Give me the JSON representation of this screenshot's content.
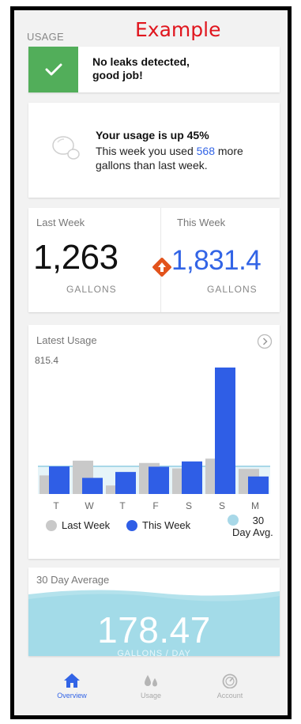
{
  "watermark": "Example",
  "section_label": "USAGE",
  "leak": {
    "message_line1": "No leaks detected,",
    "message_line2": "good job!"
  },
  "usage_up": {
    "title": "Your usage is up 45%",
    "desc_before": "This week you used ",
    "highlight": "568",
    "desc_after": " more gallons than last week."
  },
  "compare": {
    "last_label": "Last Week",
    "this_label": "This Week",
    "last_value": "1,263",
    "this_value": "1,831.4",
    "last_unit": "GALLONS",
    "this_unit": "GALLONS"
  },
  "chart_card": {
    "title": "Latest Usage",
    "next_icon": "chevron-right-circle-icon"
  },
  "chart_data": {
    "type": "bar",
    "title": "Latest Usage",
    "categories": [
      "T",
      "W",
      "T",
      "F",
      "S",
      "S",
      "M"
    ],
    "series": [
      {
        "name": "Last Week",
        "color": "#c9c9c9",
        "values": [
          120,
          215,
          55,
          200,
          165,
          228,
          162
        ]
      },
      {
        "name": "This Week",
        "color": "#2f5ee6",
        "values": [
          178,
          104,
          142,
          176,
          210,
          815.4,
          113
        ]
      }
    ],
    "reference": {
      "name": "30 Day Avg.",
      "value": 178.47,
      "color": "#a8d8e8"
    },
    "ymax_label": "815.4",
    "ylim": [
      0,
      815.4
    ]
  },
  "legend": {
    "last_week": "Last Week",
    "this_week": "This Week",
    "avg_line1": "30",
    "avg_line2": "Day Avg."
  },
  "average": {
    "title": "30 Day Average",
    "value": "178.47",
    "unit": "GALLONS / DAY"
  },
  "nav": {
    "items": [
      {
        "label": "Overview",
        "icon": "home-icon",
        "active": true
      },
      {
        "label": "Usage",
        "icon": "water-drops-icon",
        "active": false
      },
      {
        "label": "Account",
        "icon": "gauge-icon",
        "active": false
      }
    ]
  },
  "colors": {
    "accent": "#3264e6",
    "success": "#52ae5a",
    "alert": "#e2531c",
    "water": "#a8dde9"
  }
}
